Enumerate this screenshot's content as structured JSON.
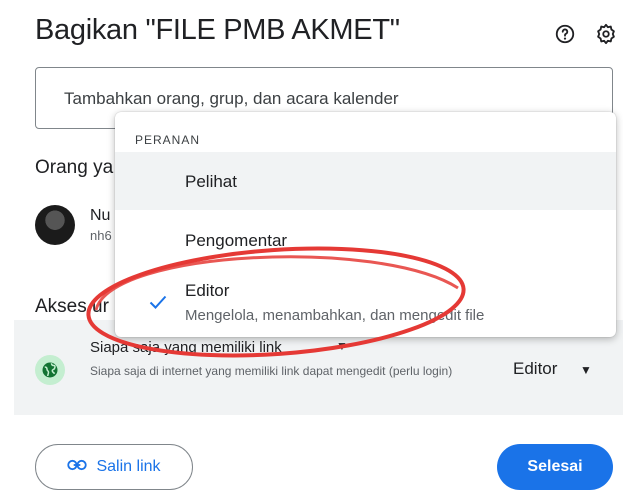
{
  "dialog": {
    "title": "Bagikan \"FILE PMB AKMET\"",
    "help_icon": "help-circle-icon",
    "settings_icon": "gear-icon"
  },
  "add_people": {
    "placeholder": "Tambahkan orang, grup, dan acara kalender"
  },
  "people": {
    "heading": "Orang ya",
    "items": [
      {
        "name": "Nu",
        "email": "nh6"
      }
    ]
  },
  "general_access": {
    "heading": "Akses ur",
    "link_title": "Siapa saja yang memiliki link",
    "link_description": "Siapa saja di internet yang memiliki link dapat mengedit (perlu login)",
    "role": "Editor"
  },
  "role_menu": {
    "heading": "PERANAN",
    "items": [
      {
        "label": "Pelihat",
        "description": "",
        "selected": false,
        "highlighted": true
      },
      {
        "label": "Pengomentar",
        "description": "",
        "selected": false,
        "highlighted": false
      },
      {
        "label": "Editor",
        "description": "Mengelola, menambahkan, dan mengedit file",
        "selected": true,
        "highlighted": false
      }
    ]
  },
  "buttons": {
    "copy_link": "Salin link",
    "done": "Selesai"
  },
  "colors": {
    "accent": "#1a73e8",
    "annotation": "#e53935",
    "panel_bg": "#f1f3f4"
  }
}
